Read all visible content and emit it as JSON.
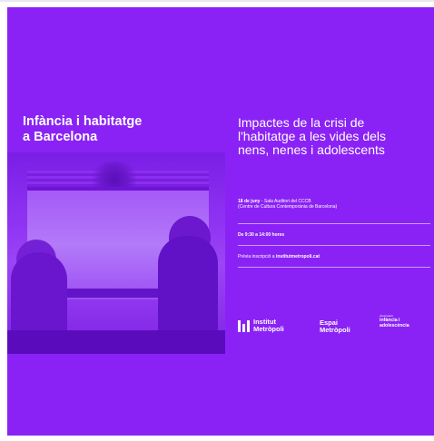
{
  "colors": {
    "background": "#8a22f5",
    "text": "#ffffff"
  },
  "poster": {
    "title_left": "Infància i habitatge\na Barcelona",
    "title_right": "Impactes de la crisi de\nl'habitatge a les vides dels\nnens, nenes i adolescents",
    "date_strong": "18 de juny",
    "date_rest": " - Sala Auditori del CCCB",
    "place": "(Centre de Cultura Contemporània de Barcelona)",
    "time": "De 9:30 a 14:00 hores",
    "registration_prefix": "Prèvia inscripció a ",
    "registration_link": "institutmetropoli.cat"
  },
  "logos": {
    "institut_metropoli": "Institut\nMetròpoli",
    "espai_metropoli": "Espai\nMetròpoli",
    "observatori_small": "observatori",
    "observatori_main": "infància i\nadolescència"
  },
  "icons": {
    "institut_metropoli_mark": "three-bar-logo-mark"
  }
}
